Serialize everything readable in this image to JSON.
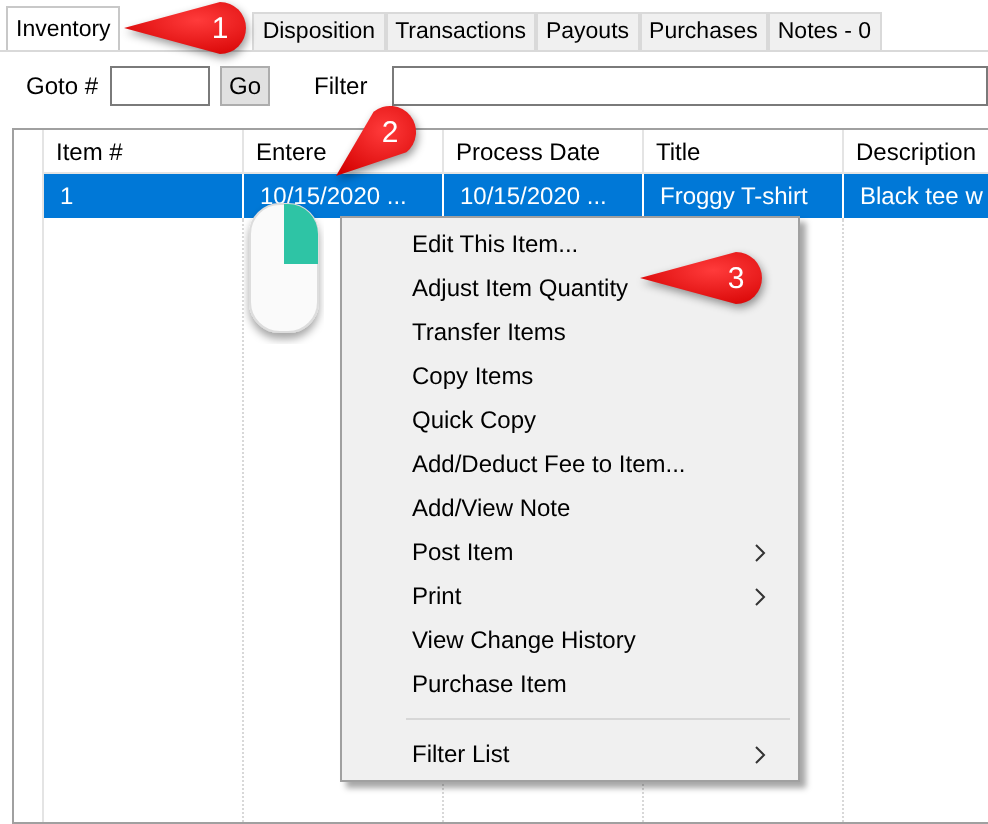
{
  "tabs": [
    {
      "label": "Inventory",
      "selected": true
    },
    {
      "label": "Disposition",
      "selected": false
    },
    {
      "label": "Transactions",
      "selected": false
    },
    {
      "label": "Payouts",
      "selected": false
    },
    {
      "label": "Purchases",
      "selected": false
    },
    {
      "label": "Notes - 0",
      "selected": false
    }
  ],
  "toolbar": {
    "goto_label": "Goto #",
    "go_button": "Go",
    "filter_label": "Filter"
  },
  "table": {
    "columns": [
      "Item #",
      "Entere",
      "Process Date",
      "Title",
      "Description"
    ],
    "rows": [
      {
        "selected": true,
        "cells": [
          "1",
          "10/15/2020 ...",
          "10/15/2020 ...",
          "Froggy T-shirt",
          "Black tee w"
        ]
      }
    ]
  },
  "context_menu": [
    {
      "kind": "item",
      "label": "Edit This Item...",
      "submenu": false
    },
    {
      "kind": "item",
      "label": "Adjust Item Quantity",
      "submenu": false
    },
    {
      "kind": "item",
      "label": "Transfer Items",
      "submenu": false
    },
    {
      "kind": "item",
      "label": "Copy Items",
      "submenu": false
    },
    {
      "kind": "item",
      "label": "Quick Copy",
      "submenu": false
    },
    {
      "kind": "item",
      "label": "Add/Deduct Fee to Item...",
      "submenu": false
    },
    {
      "kind": "item",
      "label": "Add/View Note",
      "submenu": false
    },
    {
      "kind": "item",
      "label": "Post Item",
      "submenu": true
    },
    {
      "kind": "item",
      "label": "Print",
      "submenu": true
    },
    {
      "kind": "item",
      "label": "View Change History",
      "submenu": false
    },
    {
      "kind": "item",
      "label": "Purchase Item",
      "submenu": false
    },
    {
      "kind": "separator"
    },
    {
      "kind": "item",
      "label": "Filter List",
      "submenu": true
    }
  ],
  "callouts": [
    {
      "number": "1"
    },
    {
      "number": "2"
    },
    {
      "number": "3"
    }
  ]
}
